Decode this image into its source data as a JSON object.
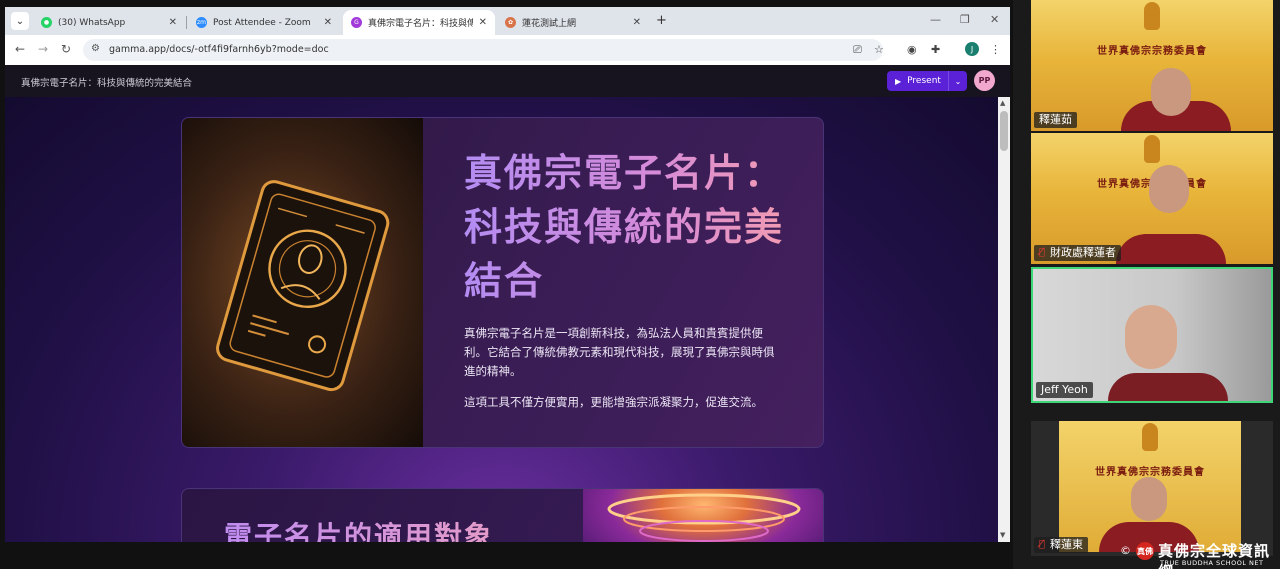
{
  "browser": {
    "tabs": [
      {
        "label": "(30) WhatsApp",
        "favicon_color": "#25d366",
        "favicon_icon": "whatsapp-icon"
      },
      {
        "label": "Post Attendee - Zoom",
        "favicon_color": "#2d8cff",
        "favicon_icon": "zoom-icon"
      },
      {
        "label": "真佛宗電子名片：科技與傳統",
        "favicon_color": "#a13ad8",
        "favicon_icon": "gamma-icon",
        "active": true
      },
      {
        "label": "蓮花測試上網",
        "favicon_color": "#d9734a",
        "favicon_icon": "lotus-icon"
      }
    ],
    "url": "gamma.app/docs/-otf4fi9farnh6yb?mode=doc",
    "profile_initial": "J"
  },
  "app": {
    "doc_title": "真佛宗電子名片：科技與傳統的完美結合",
    "present_label": "Present",
    "avatar_initials": "PP",
    "accent_color": "#5b21d6"
  },
  "card1": {
    "title": "真佛宗電子名片：科技與傳統的完美結合",
    "para1": "真佛宗電子名片是一項創新科技，為弘法人員和貴賓提供便利。它結合了傳統佛教元素和現代科技，展現了真佛宗與時俱進的精神。",
    "para2": "這項工具不僅方便實用，更能增強宗派凝聚力，促進交流。"
  },
  "card2": {
    "title": "電子名片的適用對象"
  },
  "zoom": {
    "participants": [
      {
        "name": "釋蓮茹",
        "muted": false,
        "active": false
      },
      {
        "name": "財政處釋蓮者",
        "muted": true,
        "active": false
      },
      {
        "name": "Jeff Yeoh",
        "muted": false,
        "active": true
      },
      {
        "name": "釋蓮東",
        "muted": true,
        "active": false
      }
    ],
    "banner_text": "世界真佛宗宗務委員會"
  },
  "watermark": {
    "copyright": "©",
    "logo_text": "真佛",
    "cn": "真佛宗全球資訊網",
    "en": "TRUE BUDDHA SCHOOL NET"
  }
}
